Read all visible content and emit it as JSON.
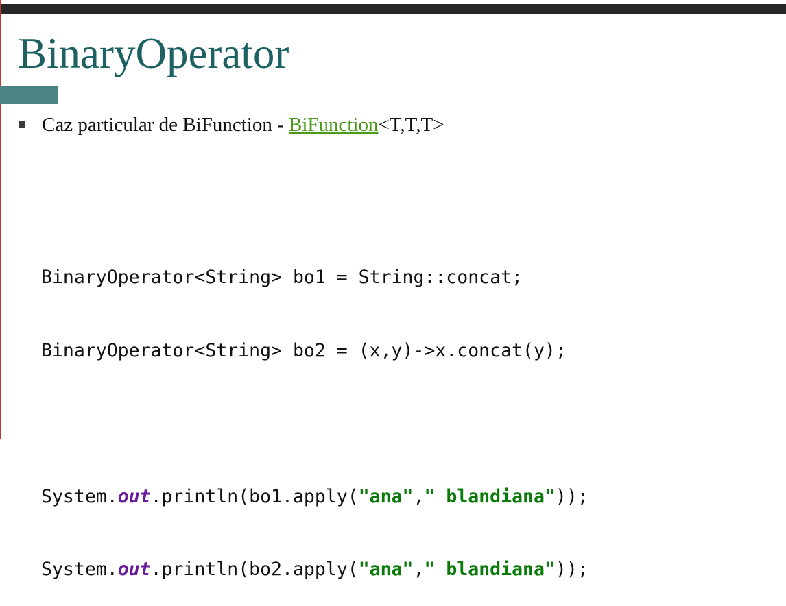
{
  "slide": {
    "title": "BinaryOperator",
    "bullet": {
      "text_before": "Caz particular de BiFunction - ",
      "link_text": "BiFunction",
      "text_after": "<T,T,T>"
    }
  },
  "code": {
    "line1": "BinaryOperator<String> bo1 = String::concat;",
    "line2": "BinaryOperator<String> bo2 = (x,y)->x.concat(y);",
    "line3": {
      "prefix": "System.",
      "field": "out",
      "middle": ".println(bo1.apply(",
      "arg1": "\"ana\"",
      "comma": ",",
      "arg2": "\" blandiana\"",
      "suffix": "));"
    },
    "line4": {
      "prefix": "System.",
      "field": "out",
      "middle": ".println(bo2.apply(",
      "arg1": "\"ana\"",
      "comma": ",",
      "arg2": "\" blandiana\"",
      "suffix": "));"
    }
  },
  "colors": {
    "title": "#1d6163",
    "accent_bar": "#4a8484",
    "link": "#4a9a1a",
    "string_literal": "#0b7a0b",
    "static_field": "#6a1b9a",
    "top_bar": "#272727"
  }
}
